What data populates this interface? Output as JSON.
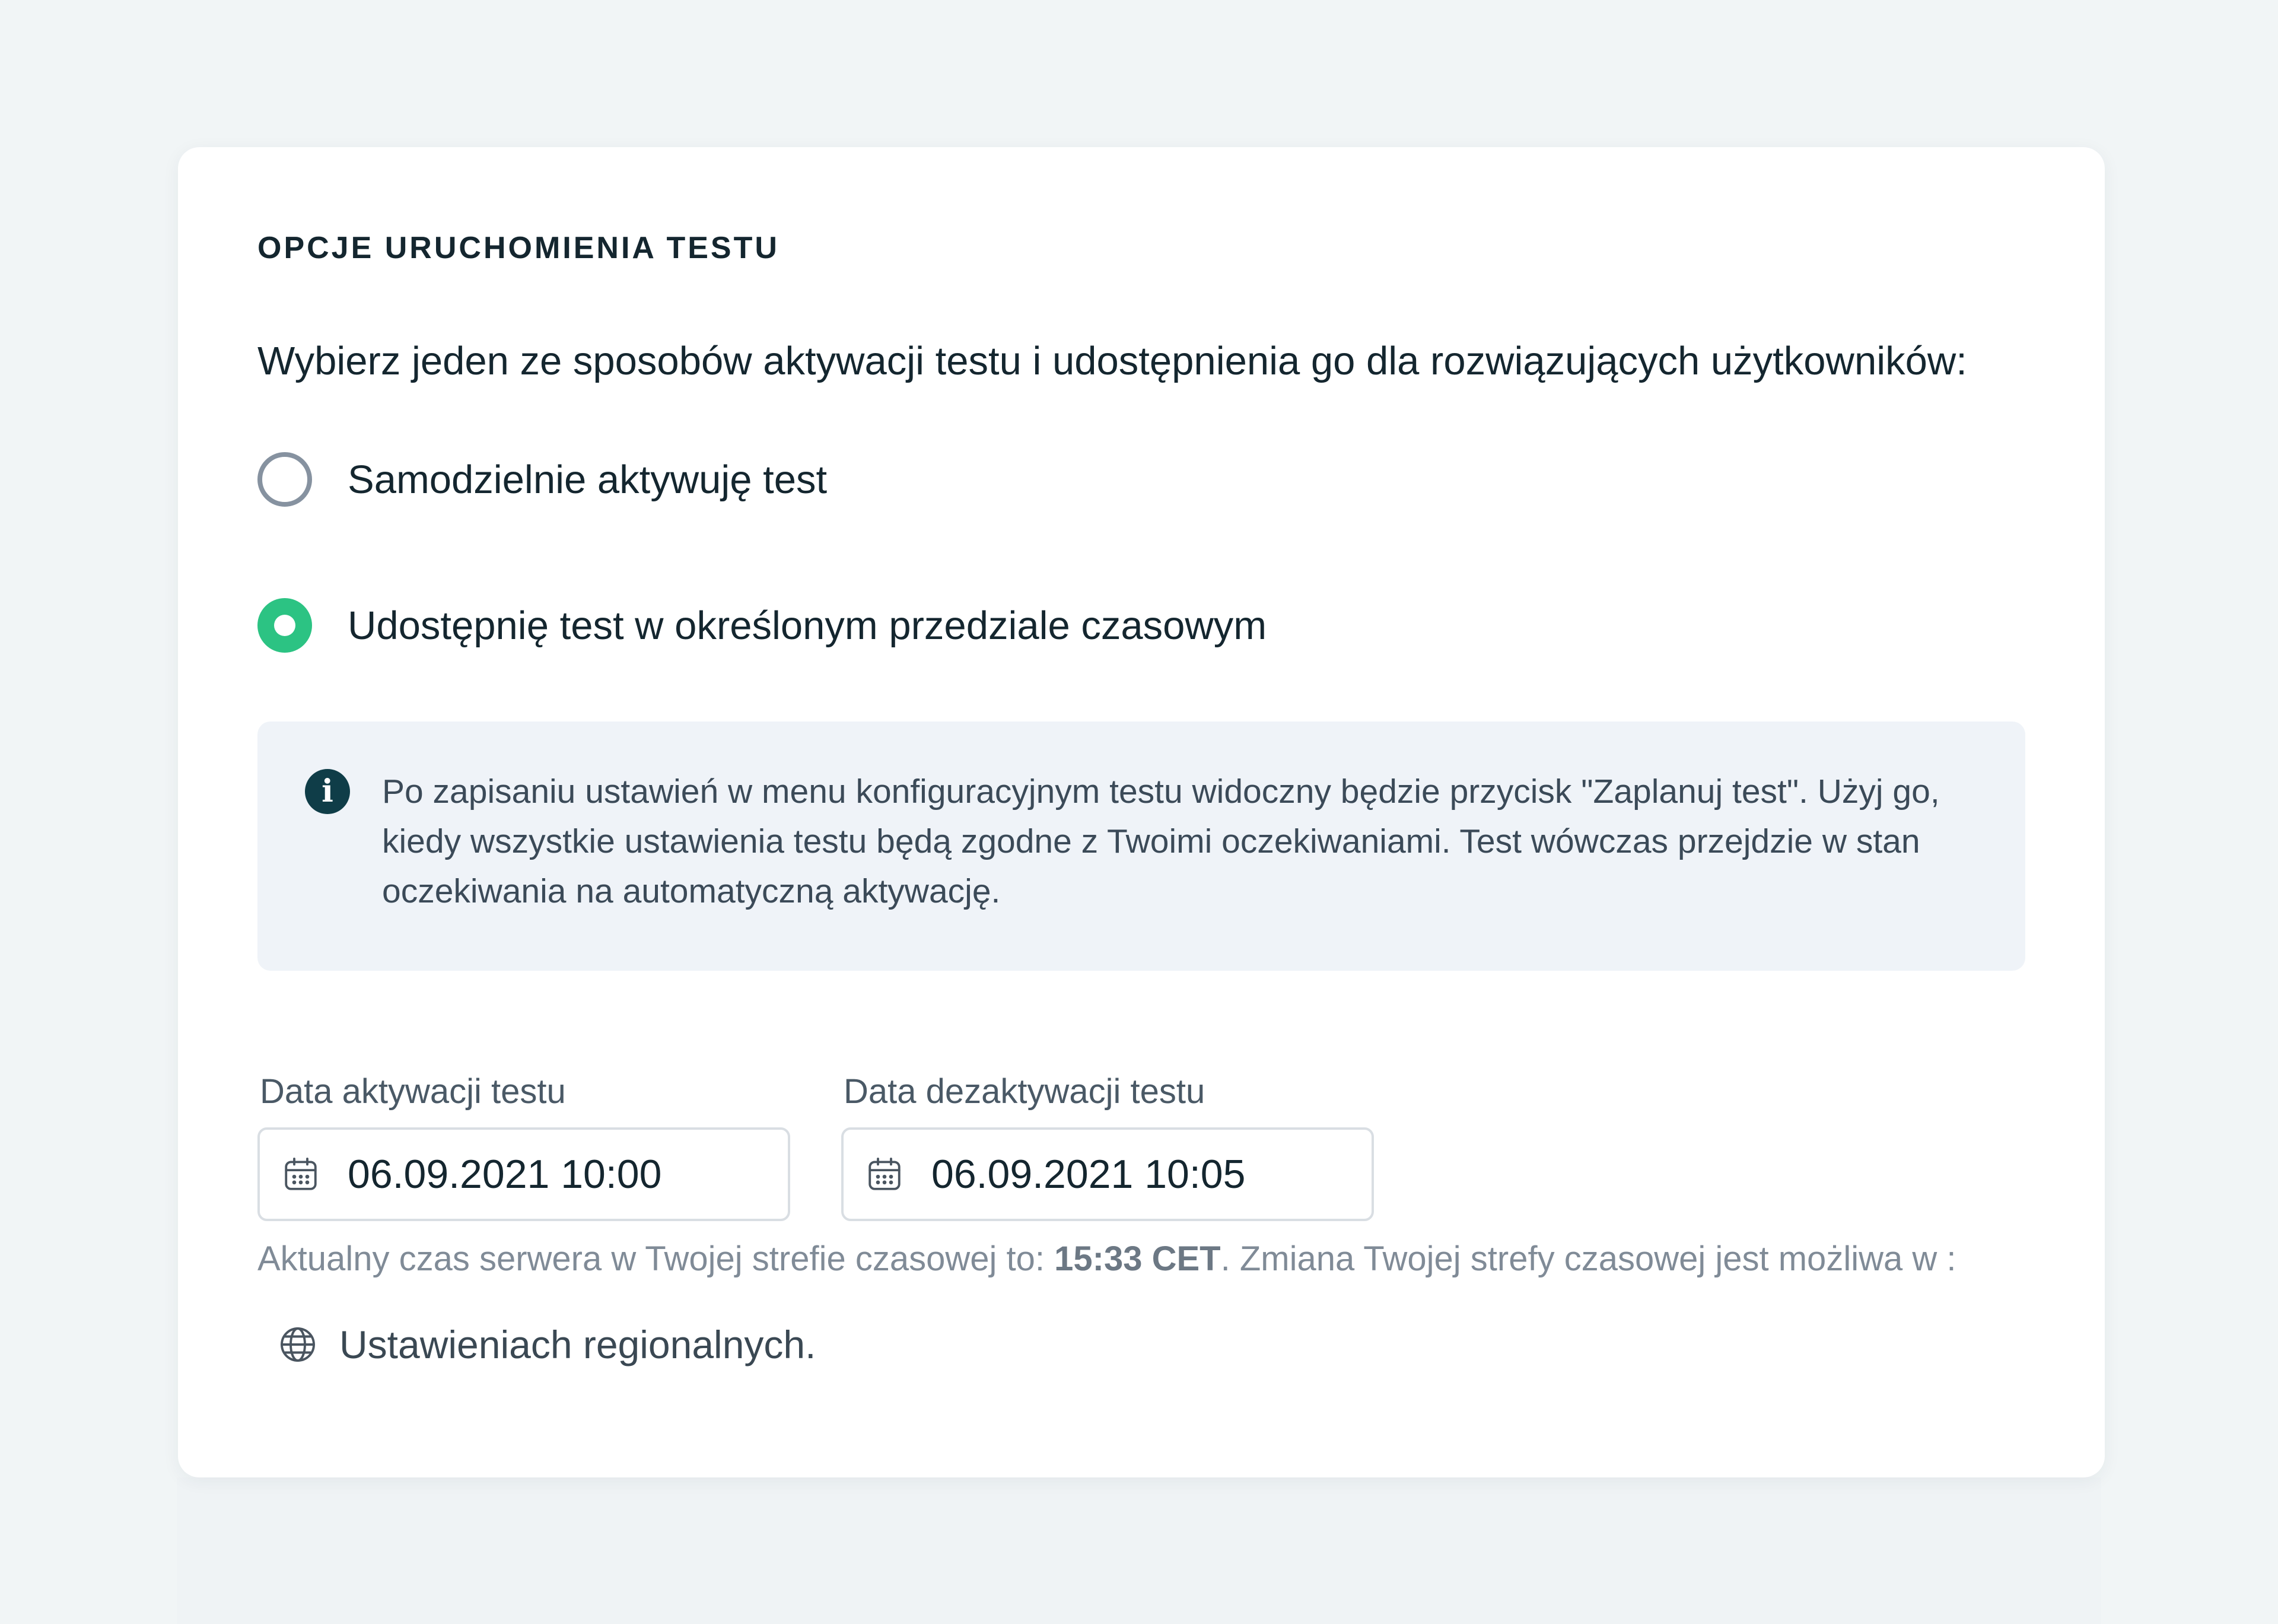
{
  "section": {
    "title": "OPCJE URUCHOMIENIA TESTU",
    "intro": "Wybierz jeden ze sposobów aktywacji testu i udostępnienia go dla rozwiązujących użytkowników:"
  },
  "options": [
    {
      "label": "Samodzielnie aktywuję test",
      "selected": false
    },
    {
      "label": "Udostępnię test w określonym przedziale czasowym",
      "selected": true
    }
  ],
  "info": {
    "icon": "info-icon",
    "text": "Po zapisaniu ustawień w menu konfiguracyjnym testu widoczny będzie przycisk \"Zaplanuj test\". Użyj go, kiedy wszystkie ustawienia testu będą zgodne z Twoimi oczekiwaniami. Test wówczas przejdzie w stan oczekiwania na automatyczną aktywację."
  },
  "activation": {
    "label": "Data aktywacji testu",
    "value": "06.09.2021 10:00",
    "icon": "calendar-icon"
  },
  "deactivation": {
    "label": "Data dezaktywacji testu",
    "value": "06.09.2021 10:05",
    "icon": "calendar-icon"
  },
  "server_time": {
    "prefix": "Aktualny czas serwera w Twojej strefie czasowej to: ",
    "time": "15:33 CET",
    "suffix": ". Zmiana Twojej strefy czasowej jest możliwa w :"
  },
  "regional_link": {
    "icon": "globe-icon",
    "label": "Ustawieniach regionalnych."
  },
  "colors": {
    "page_background": "#f1f5f6",
    "card_background": "#ffffff",
    "accent_green": "#2cc383",
    "info_icon": "#0f3d48",
    "info_background": "#eff3f8"
  }
}
